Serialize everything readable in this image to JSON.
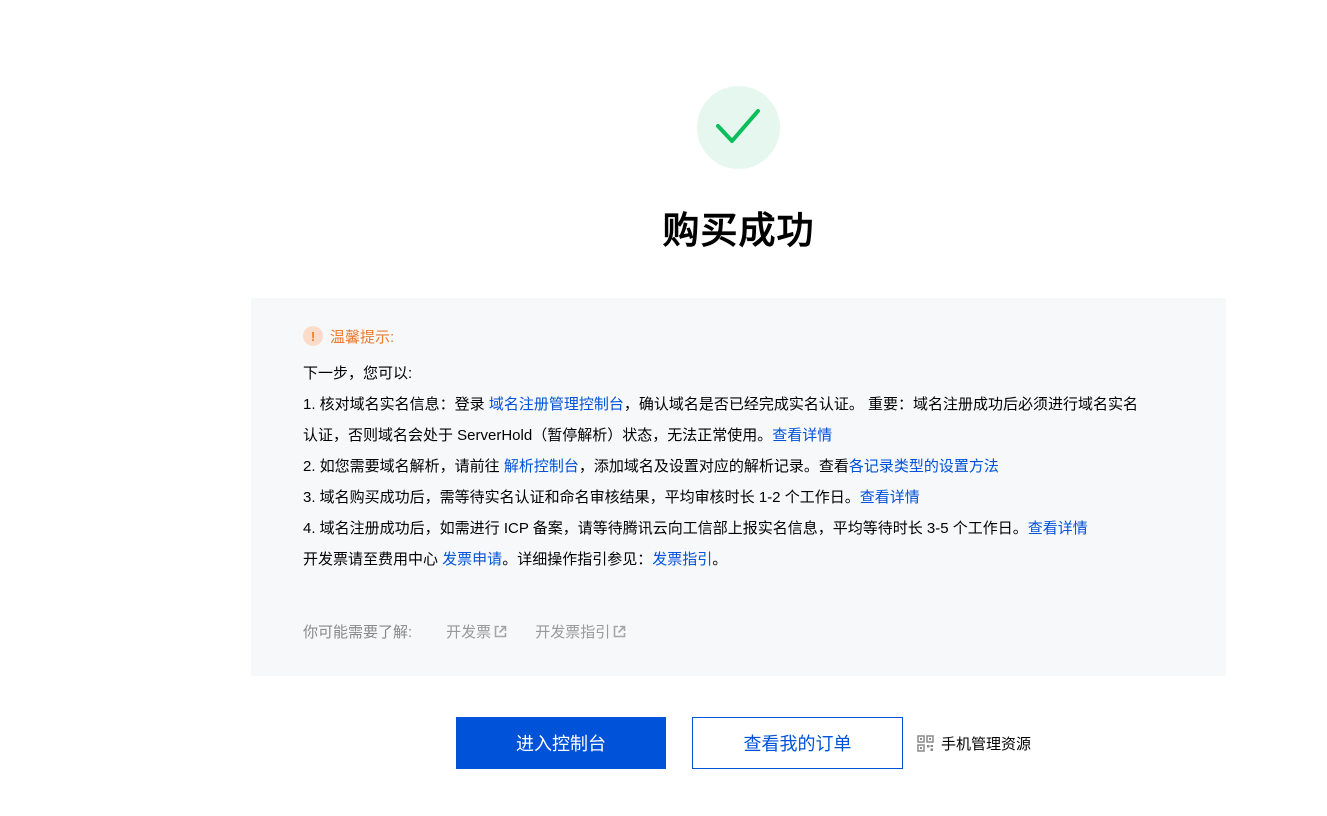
{
  "status": {
    "icon": "check-icon",
    "title": "购买成功",
    "accent_color": "#0abf5b",
    "circle_color": "#e6f7f0"
  },
  "tips": {
    "icon": "exclamation-icon",
    "title": "温馨提示:",
    "intro": "下一步，您可以:",
    "item1": {
      "prefix": "1. 核对域名实名信息：登录 ",
      "link": "域名注册管理控制台",
      "middle": "，确认域名是否已经完成实名认证。 重要：域名注册成功后必须进行域名实名",
      "line2": "认证，否则域名会处于 ServerHold（暂停解析）状态，无法正常使用。",
      "link2": "查看详情"
    },
    "item2": {
      "prefix": "2. 如您需要域名解析，请前往 ",
      "link": "解析控制台",
      "middle": "，添加域名及设置对应的解析记录。查看",
      "link2": "各记录类型的设置方法"
    },
    "item3": {
      "text": "3. 域名购买成功后，需等待实名认证和命名审核结果，平均审核时长 1-2 个工作日。",
      "link": "查看详情"
    },
    "item4": {
      "text": "4. 域名注册成功后，如需进行 ICP 备案，请等待腾讯云向工信部上报实名信息，平均等待时长 3-5 个工作日。",
      "link": "查看详情"
    },
    "invoice": {
      "prefix": "开发票请至费用中心 ",
      "link": "发票申请",
      "middle": "。详细操作指引参见：",
      "link2": "发票指引",
      "suffix": "。"
    }
  },
  "related": {
    "label": "你可能需要了解:",
    "links": [
      {
        "label": "开发票",
        "icon": "external-link-icon"
      },
      {
        "label": "开发票指引",
        "icon": "external-link-icon"
      }
    ]
  },
  "actions": {
    "primary_label": "进入控制台",
    "secondary_label": "查看我的订单",
    "mobile_label": "手机管理资源",
    "mobile_icon": "qr-code-icon",
    "primary_color": "#0052d9"
  }
}
